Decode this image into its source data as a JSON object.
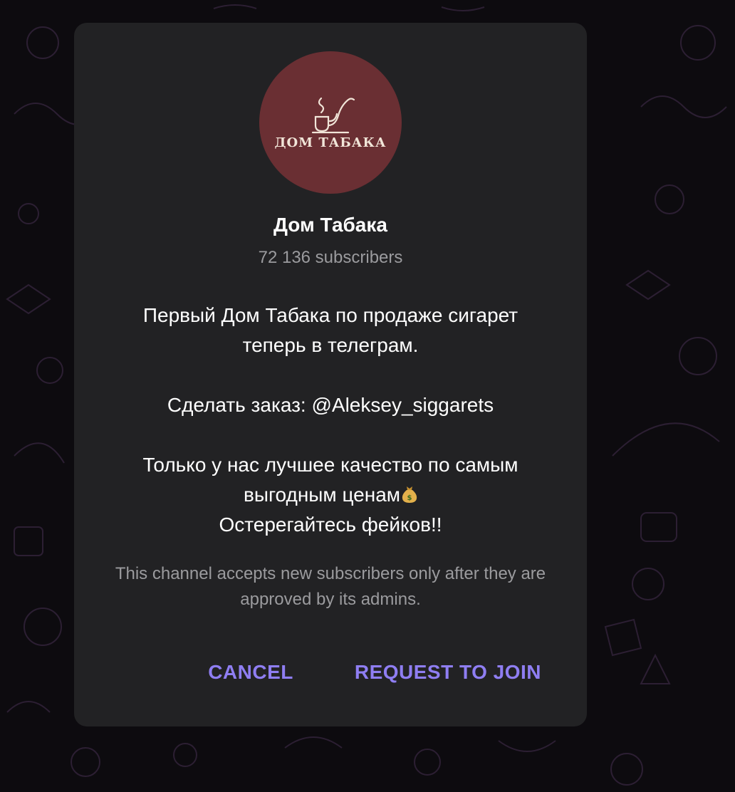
{
  "channel": {
    "avatar_text": "ДОМ ТАБАКА",
    "title": "Дом Табака",
    "subscribers": "72 136 subscribers",
    "description": {
      "line1": "Первый Дом Табака по продаже сигарет",
      "line2": "теперь в телеграм.",
      "line3": "Сделать заказ: @Aleksey_siggarets",
      "line4": "Только у нас лучшее качество по самым",
      "line5": "выгодным ценам",
      "line6": "Остерегайтесь фейков!!"
    },
    "notice": "This channel accepts new subscribers only after they are approved by its admins."
  },
  "actions": {
    "cancel_label": "CANCEL",
    "join_label": "REQUEST TO JOIN"
  },
  "colors": {
    "background": "#0d0b0f",
    "dialog": "#222224",
    "avatar": "#6a2f33",
    "accent": "#8f7ef2",
    "muted_text": "#9b9b9e"
  },
  "icons": {
    "avatar_logo": "pipe-icon",
    "emoji": "money-bag-icon"
  }
}
